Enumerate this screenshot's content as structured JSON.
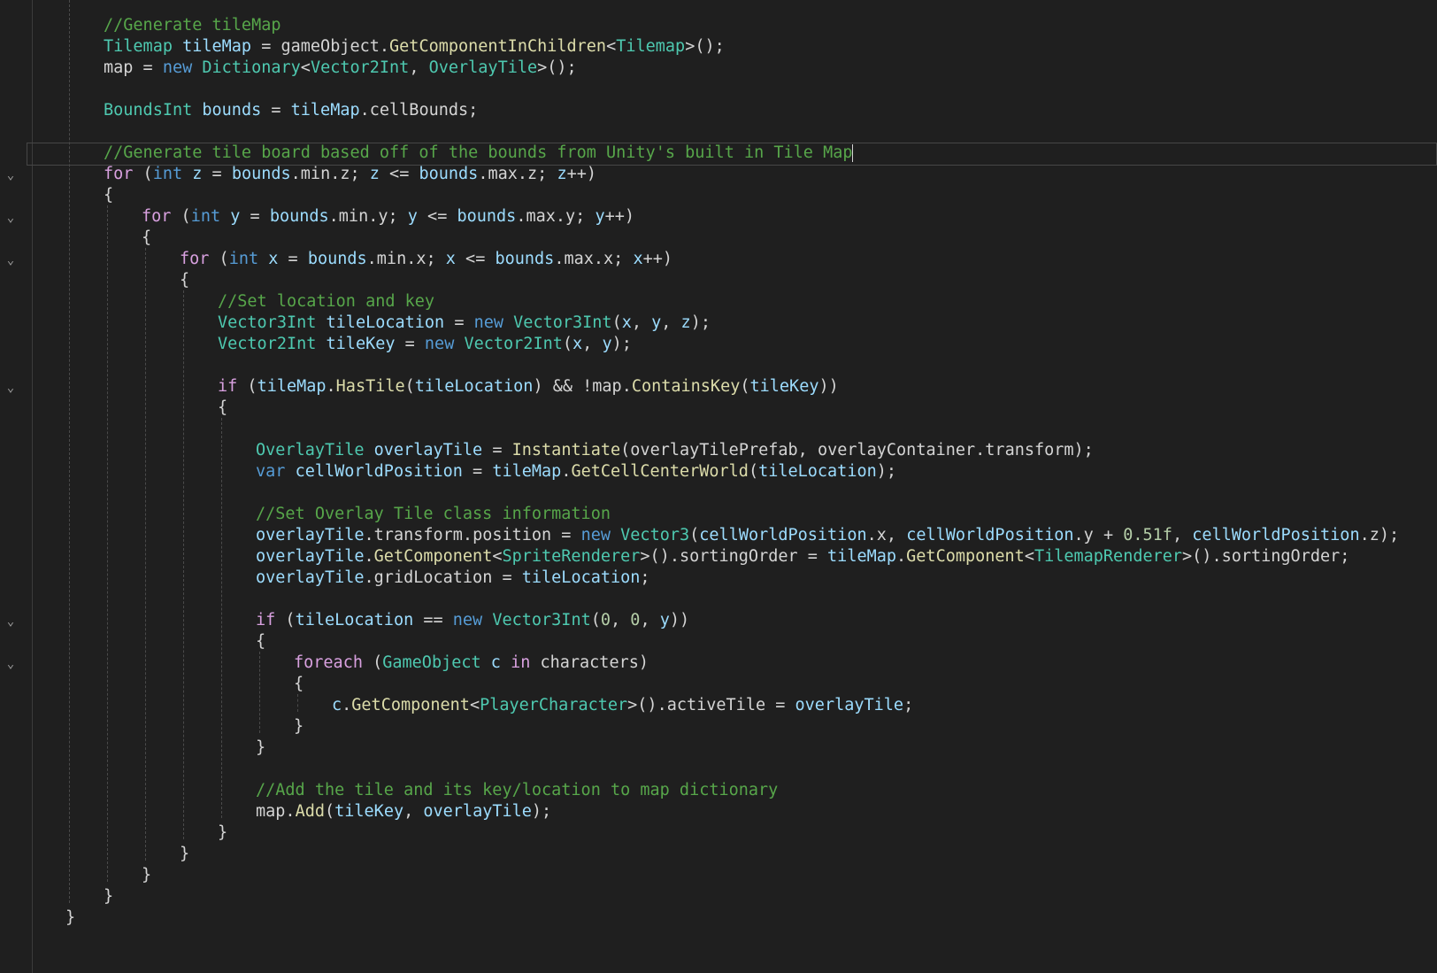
{
  "editor": {
    "language": "C#",
    "lines": {
      "l01": "//Generate tileMap",
      "l19": "//Set location and key",
      "l31": "//Set Overlay Tile class information",
      "l45": "//Add the tile and its key/location to map dictionary",
      "l07": "//Generate tile board based off of the bounds from Unity's built in Tile Map"
    },
    "tokens": {
      "tilemap_type": "Tilemap",
      "tileMap_var": "tileMap",
      "gameObject": "gameObject",
      "getComponentInChildren": "GetComponentInChildren",
      "map": "map",
      "new": "new",
      "dictionary": "Dictionary",
      "vector2int": "Vector2Int",
      "overlayTile_type": "OverlayTile",
      "boundsInt": "BoundsInt",
      "bounds": "bounds",
      "cellBounds": "cellBounds",
      "for": "for",
      "int": "int",
      "min": "min",
      "max": "max",
      "vector3int": "Vector3Int",
      "tileLocation": "tileLocation",
      "tileKey": "tileKey",
      "if": "if",
      "hasTile": "HasTile",
      "containsKey": "ContainsKey",
      "overlayTile_var": "overlayTile",
      "instantiate": "Instantiate",
      "overlayTilePrefab": "overlayTilePrefab",
      "overlayContainer": "overlayContainer",
      "transform": "transform",
      "var": "var",
      "cellWorldPosition": "cellWorldPosition",
      "getCellCenterWorld": "GetCellCenterWorld",
      "position": "position",
      "vector3": "Vector3",
      "num051": "0.51f",
      "getComponent": "GetComponent",
      "spriteRenderer": "SpriteRenderer",
      "sortingOrder": "sortingOrder",
      "tilemapRenderer": "TilemapRenderer",
      "gridLocation": "gridLocation",
      "zero": "0",
      "foreach": "foreach",
      "gameObject_type": "GameObject",
      "c": "c",
      "in": "in",
      "characters": "characters",
      "playerCharacter": "PlayerCharacter",
      "activeTile": "activeTile",
      "add": "Add"
    }
  }
}
